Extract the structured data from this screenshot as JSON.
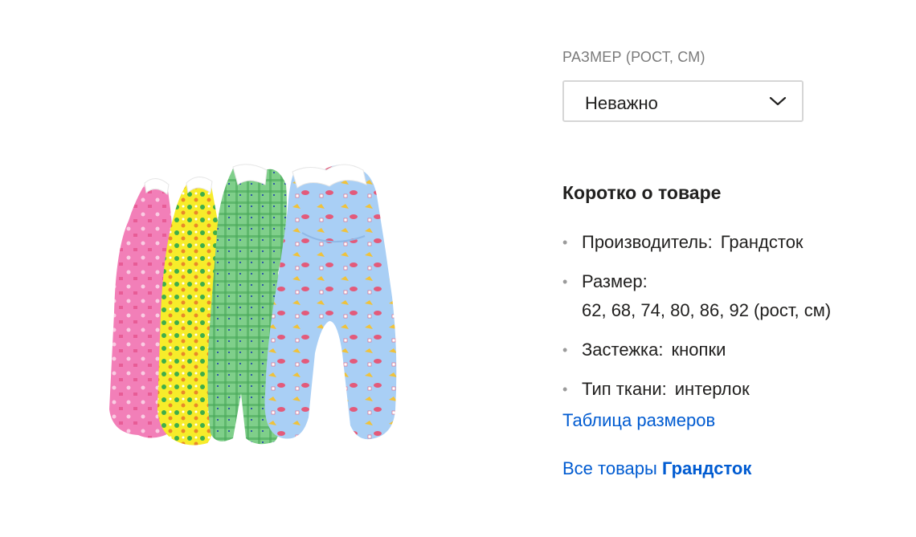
{
  "filter": {
    "label": "РАЗМЕР (РОСТ, СМ)",
    "selected": "Неважно"
  },
  "summary": {
    "title": "Коротко о товаре",
    "facts": [
      {
        "key": "Производитель:",
        "value": "Грандсток"
      },
      {
        "key": "Размер:",
        "value": "62, 68, 74, 80, 86, 92 (рост, см)"
      },
      {
        "key": "Застежка:",
        "value": "кнопки"
      },
      {
        "key": "Тип ткани:",
        "value": "интерлок"
      }
    ]
  },
  "links": {
    "size_table": "Таблица размеров",
    "all_goods_prefix": "Все товары",
    "all_goods_brand": "Грандсток"
  },
  "colors": {
    "link": "#005bd1",
    "muted": "#7a7a7a",
    "text": "#21201f",
    "romper_pink": "#f27fb8",
    "romper_yellow": "#f7ec2a",
    "romper_green": "#7fcf8a",
    "romper_blue": "#a9cff5"
  }
}
